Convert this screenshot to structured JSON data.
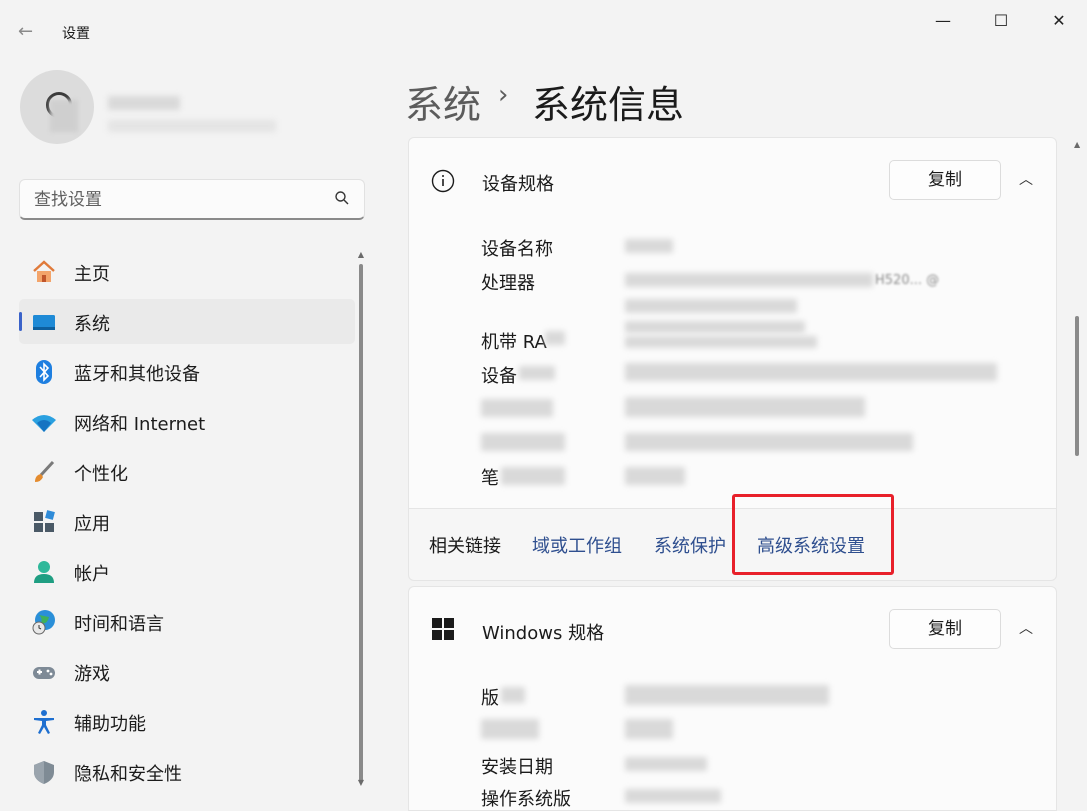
{
  "window": {
    "title": "设置",
    "controls": {
      "minimize": "—",
      "maximize": "☐",
      "close": "✕"
    }
  },
  "search": {
    "placeholder": "查找设置"
  },
  "nav": {
    "items": [
      {
        "label": "主页",
        "icon": "home-icon"
      },
      {
        "label": "系统",
        "icon": "system-icon",
        "active": true
      },
      {
        "label": "蓝牙和其他设备",
        "icon": "bluetooth-icon"
      },
      {
        "label": "网络和 Internet",
        "icon": "wifi-icon"
      },
      {
        "label": "个性化",
        "icon": "brush-icon"
      },
      {
        "label": "应用",
        "icon": "apps-icon"
      },
      {
        "label": "帐户",
        "icon": "account-icon"
      },
      {
        "label": "时间和语言",
        "icon": "globe-clock-icon"
      },
      {
        "label": "游戏",
        "icon": "gamepad-icon"
      },
      {
        "label": "辅助功能",
        "icon": "accessibility-icon"
      },
      {
        "label": "隐私和安全性",
        "icon": "shield-icon"
      }
    ]
  },
  "breadcrumb": {
    "parent": "系统",
    "separator": "›",
    "current": "系统信息"
  },
  "device_specs": {
    "title": "设备规格",
    "copy_label": "复制",
    "fields": {
      "device_name": "设备名称",
      "processor": "处理器",
      "processor_fragment": "H520... @",
      "ram_prefix": "机带 RA",
      "device_prefix": "设备",
      "pen_prefix": "笔"
    }
  },
  "related_links": {
    "label": "相关链接",
    "links": [
      "域或工作组",
      "系统保护",
      "高级系统设置"
    ]
  },
  "windows_specs": {
    "title": "Windows 规格",
    "copy_label": "复制",
    "fields": {
      "edition_prefix": "版",
      "install_date_prefix": "安装日期",
      "os_build_prefix": "操作系统版"
    }
  },
  "colors": {
    "accent": "#3a62c9",
    "link": "#2f4f8f",
    "highlight_box": "#e8202a"
  }
}
